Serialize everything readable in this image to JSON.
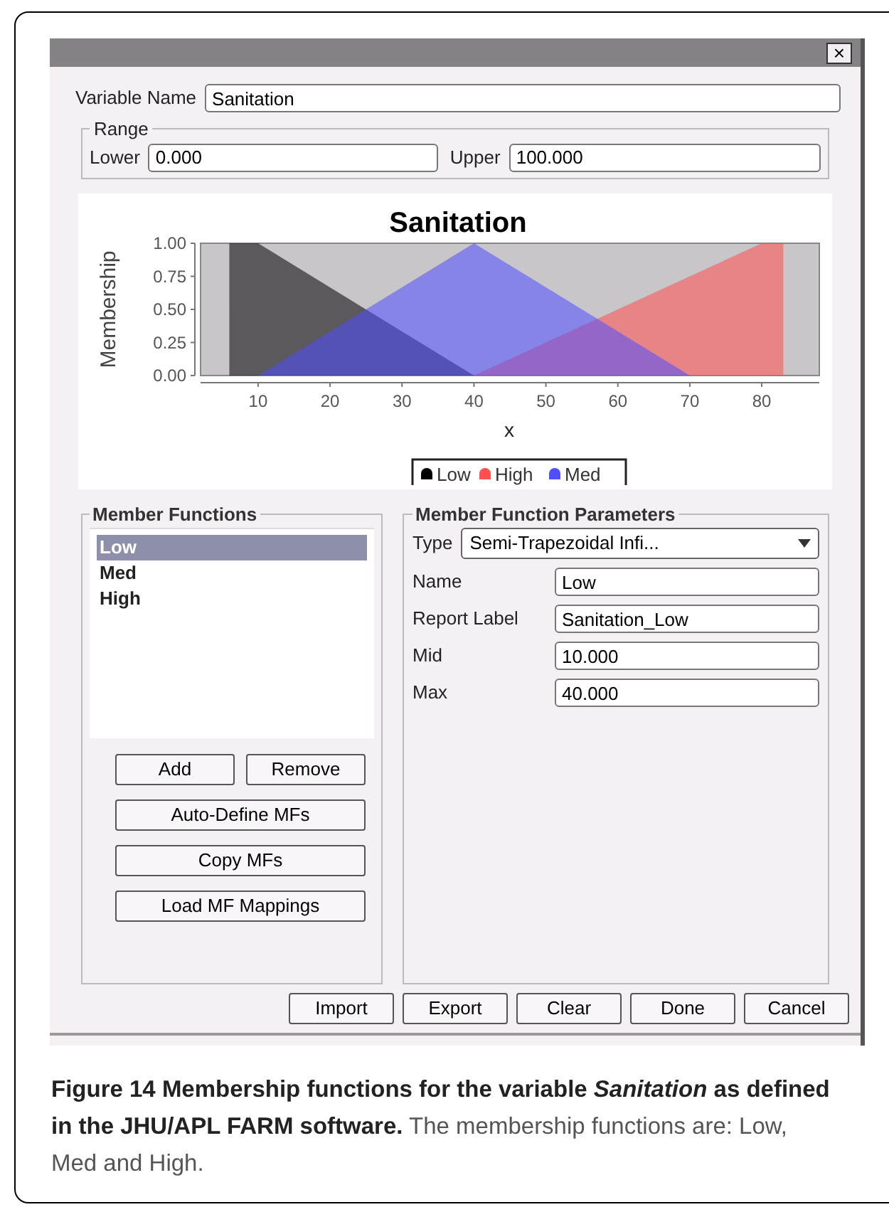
{
  "window": {
    "close": "×"
  },
  "variable_name": {
    "label": "Variable Name",
    "value": "Sanitation"
  },
  "range": {
    "legend": "Range",
    "lower": {
      "label": "Lower",
      "value": "0.000"
    },
    "upper": {
      "label": "Upper",
      "value": "100.000"
    }
  },
  "chart": {
    "chart_data": {
      "type": "area",
      "legend": "bottom",
      "title": "Sanitation",
      "xlabel": "x",
      "ylabel": "Membership",
      "x": [
        6,
        10,
        40,
        70,
        80,
        83
      ],
      "xlim": [
        2,
        88
      ],
      "ylim": [
        0,
        1
      ],
      "xticks": [
        10,
        20,
        30,
        40,
        50,
        60,
        70,
        80
      ],
      "yticks": [
        {
          "value": 0,
          "label": "0.00"
        },
        {
          "value": 0.25,
          "label": "0.25"
        },
        {
          "value": 0.5,
          "label": "0.50"
        },
        {
          "value": 0.75,
          "label": "0.75"
        },
        {
          "value": 1,
          "label": "1.00"
        }
      ],
      "series": [
        {
          "name": "Low",
          "color": "#000000",
          "values": [
            1,
            1,
            0,
            null,
            null,
            null
          ]
        },
        {
          "name": "High",
          "color": "#ff4f4f",
          "values": [
            null,
            null,
            0,
            0.75,
            1,
            1
          ]
        },
        {
          "name": "Med",
          "color": "#4f4fff",
          "values": [
            null,
            0,
            1,
            0,
            null,
            null
          ]
        }
      ]
    }
  },
  "member_functions": {
    "legend": "Member Functions",
    "items": [
      {
        "label": "Low",
        "selected": true
      },
      {
        "label": "Med",
        "selected": false
      },
      {
        "label": "High",
        "selected": false
      }
    ],
    "buttons": [
      "Add",
      "Remove",
      "Auto-Define MFs",
      "Copy MFs",
      "Load MF Mappings"
    ]
  },
  "parameters": {
    "legend": "Member Function Parameters",
    "type": {
      "label": "Type",
      "value": "Semi-Trapezoidal Infi..."
    },
    "fields": [
      {
        "label": "Name",
        "value": "Low"
      },
      {
        "label": "Report Label",
        "value": "Sanitation_Low"
      },
      {
        "label": "Mid",
        "value": "10.000"
      },
      {
        "label": "Max",
        "value": "40.000"
      }
    ]
  },
  "buttons": [
    "Import",
    "Export",
    "Clear",
    "Done",
    "Cancel"
  ],
  "caption": {
    "title_start": "Figure 14 Membership functions for the variable",
    "title_italic": "Sanitation",
    "title_end": "as defined in the JHU/APL FARM software.",
    "body": "The membership functions are: Low, Med and High."
  }
}
